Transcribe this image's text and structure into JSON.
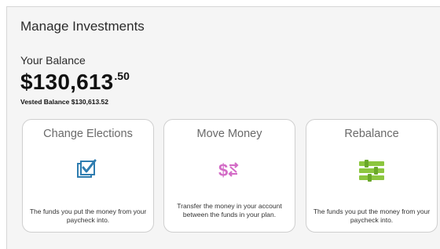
{
  "page": {
    "title": "Manage Investments"
  },
  "balance": {
    "label": "Your Balance",
    "amount_main": "$130,613",
    "amount_cents": ".50",
    "vested": "Vested Balance $130,613.52"
  },
  "cards": [
    {
      "title": "Change Elections",
      "icon": "checkbox-icon",
      "desc": "The funds you put the money from your paycheck into.",
      "icon_color": "#2f7db0"
    },
    {
      "title": "Move Money",
      "icon": "transfer-dollar-icon",
      "desc": "Transfer the money in your account between the funds in your plan.",
      "icon_color": "#d36bc6"
    },
    {
      "title": "Rebalance",
      "icon": "sliders-icon",
      "desc": "The funds you put the money from your paycheck into.",
      "icon_color": "#8cc63f"
    }
  ]
}
